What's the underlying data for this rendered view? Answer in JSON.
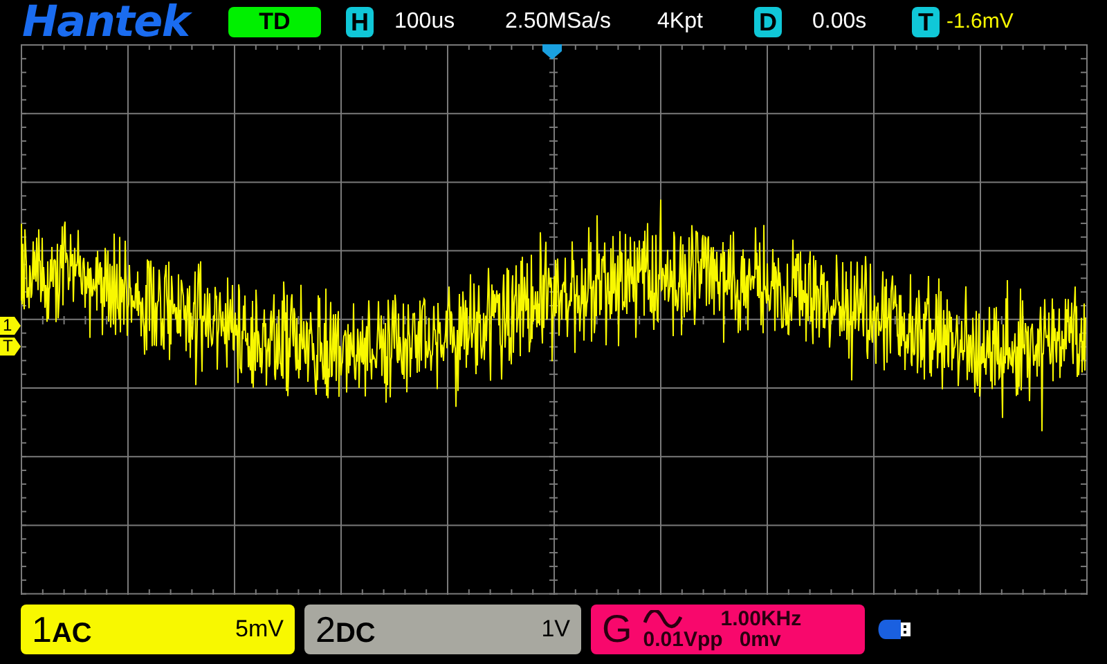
{
  "header": {
    "logo": "Hantek",
    "trigger_status": "TD",
    "timebase": {
      "badge": "H",
      "value": "100us"
    },
    "sample_rate": "2.50MSa/s",
    "memory_depth": "4Kpt",
    "delay": {
      "badge": "D",
      "value": "0.00s"
    },
    "trigger_level": {
      "badge": "T",
      "value": "-1.6mV"
    }
  },
  "screen": {
    "markers": [
      {
        "label": "1"
      },
      {
        "label": "T"
      }
    ]
  },
  "channels": [
    {
      "number": "1",
      "coupling": "AC",
      "scale": "5mV",
      "color": "#f8f800"
    },
    {
      "number": "2",
      "coupling": "DC",
      "scale": "1V",
      "color": "#a8a8a0"
    }
  ],
  "generator": {
    "badge": "G",
    "frequency": "1.00KHz",
    "amplitude": "0.01Vpp",
    "offset": "0mv"
  }
}
